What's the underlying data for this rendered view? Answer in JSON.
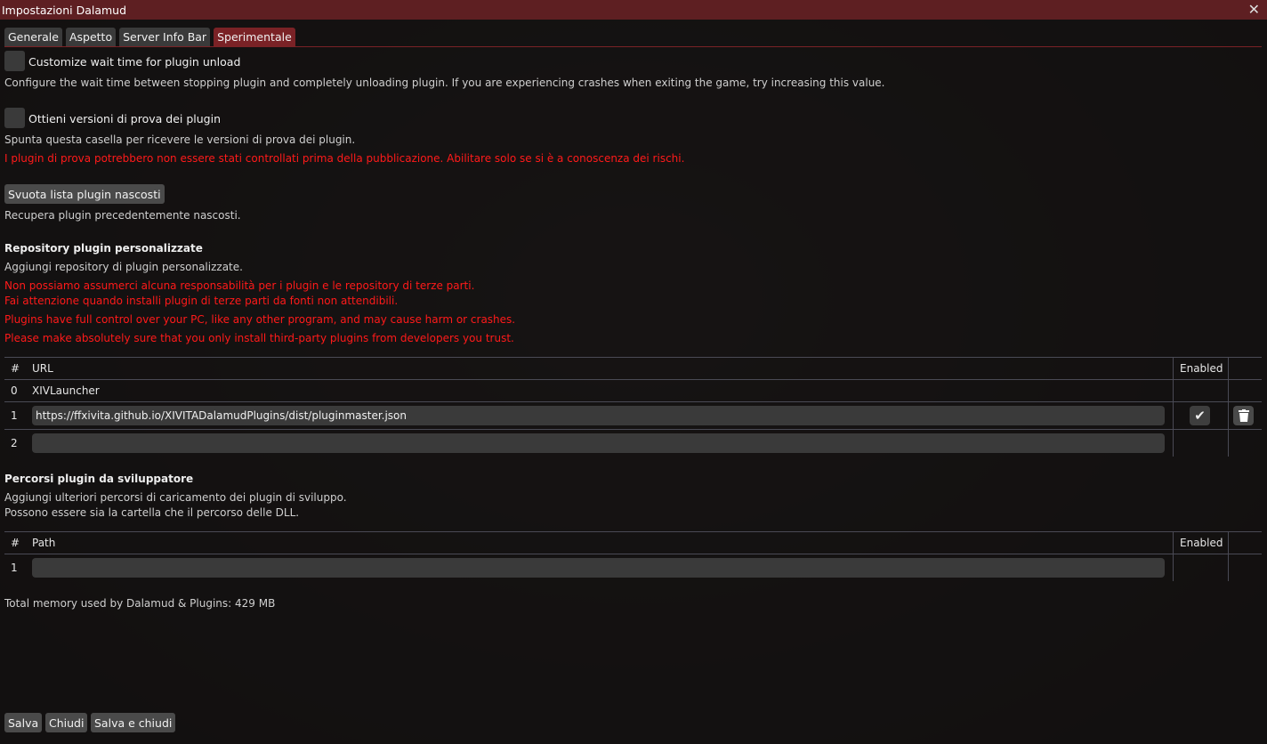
{
  "window": {
    "title": "Impostazioni Dalamud",
    "close_icon": "close-icon"
  },
  "tabs": [
    {
      "label": "Generale"
    },
    {
      "label": "Aspetto"
    },
    {
      "label": "Server Info Bar"
    },
    {
      "label": "Sperimentale",
      "active": true
    }
  ],
  "wait_time": {
    "label": "Customize wait time for plugin unload",
    "checked": false,
    "description": "Configure the wait time between stopping plugin and completely unloading plugin. If you are experiencing crashes when exiting the game, try increasing this value."
  },
  "testing": {
    "label": "Ottieni versioni di prova dei plugin",
    "checked": false,
    "description": "Spunta questa casella per ricevere le versioni di prova dei plugin.",
    "warning": "I plugin di prova potrebbero non essere stati controllati prima della pubblicazione. Abilitare solo se si è a conoscenza dei rischi."
  },
  "hidden": {
    "button": "Svuota lista plugin nascosti",
    "description": "Recupera plugin precedentemente nascosti."
  },
  "repos": {
    "heading": "Repository plugin personalizzate",
    "description": "Aggiungi repository di plugin personalizzate.",
    "warnings": [
      "Non possiamo assumerci alcuna responsabilità per i plugin e le repository di terze parti.",
      "Fai attenzione quando installi plugin di terze parti da fonti non attendibili.",
      "Plugins have full control over your PC, like any other program, and may cause harm or crashes.",
      "Please make absolutely sure that you only install third-party plugins from developers you trust."
    ],
    "columns": {
      "num": "#",
      "url": "URL",
      "enabled": "Enabled"
    },
    "rows": [
      {
        "num": "0",
        "url": "XIVLauncher"
      },
      {
        "num": "1",
        "url": "https://ffxivita.github.io/XIVITADalamudPlugins/dist/pluginmaster.json",
        "enabled": true
      },
      {
        "num": "2",
        "url": ""
      }
    ]
  },
  "devpaths": {
    "heading": "Percorsi plugin da sviluppatore",
    "description": [
      "Aggiungi ulteriori percorsi di caricamento dei plugin di sviluppo.",
      "Possono essere sia la cartella che il percorso delle DLL."
    ],
    "columns": {
      "num": "#",
      "path": "Path",
      "enabled": "Enabled"
    },
    "rows": [
      {
        "num": "1",
        "path": ""
      }
    ]
  },
  "memory": "Total memory used by Dalamud & Plugins: 429 MB",
  "footer": {
    "save": "Salva",
    "close": "Chiudi",
    "save_close": "Salva e chiudi"
  }
}
